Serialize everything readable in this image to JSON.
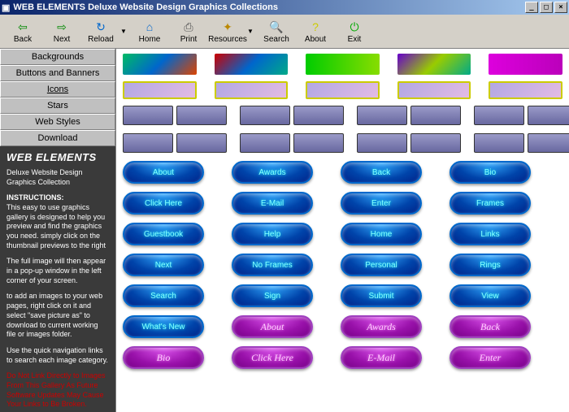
{
  "window": {
    "title": "WEB ELEMENTS Deluxe Website Design Graphics Collections"
  },
  "toolbar": {
    "back": "Back",
    "next": "Next",
    "reload": "Reload",
    "home": "Home",
    "print": "Print",
    "resources": "Resources",
    "search": "Search",
    "about": "About",
    "exit": "Exit"
  },
  "sidebar": {
    "tabs": [
      "Backgrounds",
      "Buttons and Banners",
      "Icons",
      "Stars",
      "Web Styles",
      "Download"
    ],
    "heading": "WEB ELEMENTS",
    "sub": "Deluxe Website Design Graphics Collection",
    "instr_head": "INSTRUCTIONS:",
    "instr1": "This easy to use graphics gallery is designed to help you preview and find the graphics you need. simply click on the thumbnail previews to the right",
    "instr2": "The full image will then appear in a pop-up window in the left corner of your screen.",
    "instr3": "to add an images to your web pages, right click on it and select \"save picture as\" to download to current working file or images folder.",
    "instr4": "Use the quick navigation links to search each image category.",
    "warn": "Do Not Link Directly to Images From This Gallery As Future Software Updates May Cause Your Links to Be Broken."
  },
  "pills": {
    "r1": [
      "About",
      "Awards",
      "Back",
      "Bio"
    ],
    "r2": [
      "Click Here",
      "E-Mail",
      "Enter",
      "Frames"
    ],
    "r3": [
      "Guestbook",
      "Help",
      "Home",
      "Links"
    ],
    "r4": [
      "Next",
      "No Frames",
      "Personal",
      "Rings"
    ],
    "r5": [
      "Search",
      "Sign",
      "Submit",
      "View"
    ],
    "r6": [
      "What's New",
      "About",
      "Awards",
      "Back"
    ],
    "r7": [
      "Bio",
      "Click Here",
      "E-Mail",
      "Enter"
    ]
  }
}
